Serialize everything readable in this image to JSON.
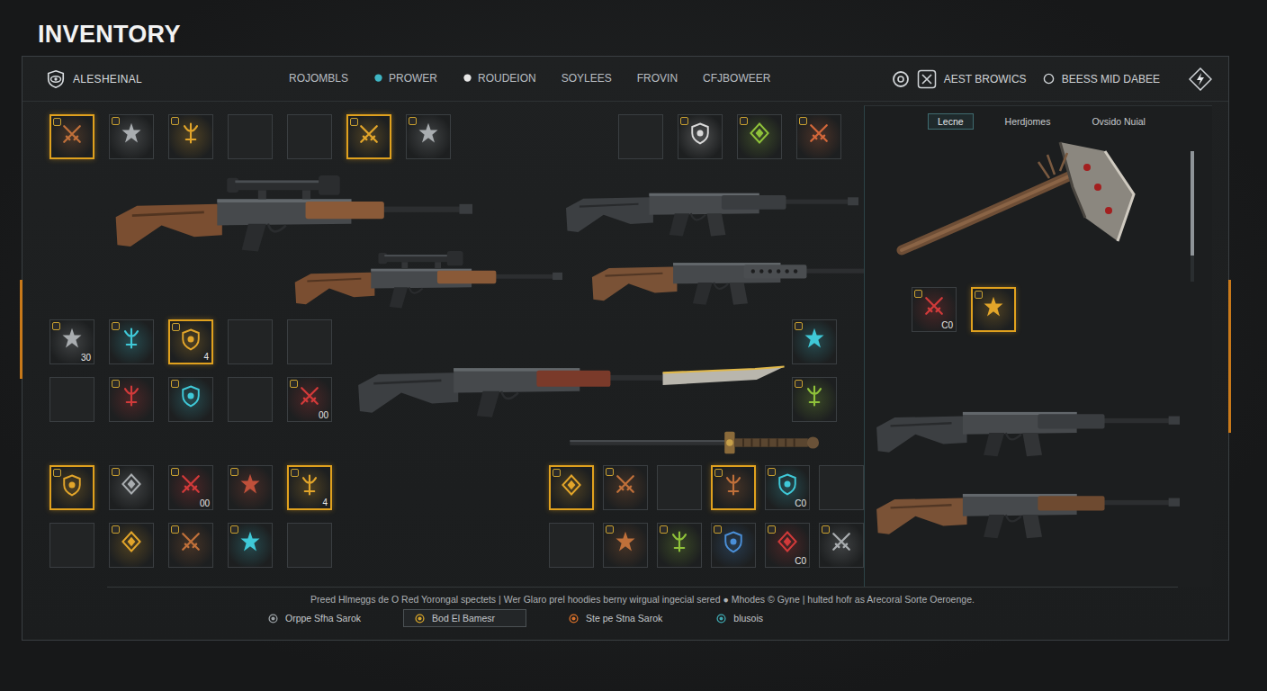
{
  "title": "INVENTORY",
  "header": {
    "brand": "ALESHEINAL",
    "tabs": [
      {
        "label": "ROJOMBLS",
        "selected": false,
        "kind": "plain"
      },
      {
        "label": "PROWER",
        "selected": false,
        "kind": "marked",
        "color": "#3fb6c4"
      },
      {
        "label": "ROUDEION",
        "selected": false,
        "kind": "marked",
        "color": "#e6e6e6"
      },
      {
        "label": "SOYLEES",
        "selected": false,
        "kind": "plain"
      },
      {
        "label": "FROVIN",
        "selected": false,
        "kind": "plain"
      },
      {
        "label": "CFJBOWEER",
        "selected": false,
        "kind": "plain"
      }
    ],
    "tools": [
      {
        "label": "AEST BROWICS",
        "kind": "icons"
      },
      {
        "label": "BEESS MID DABEE",
        "kind": "radio"
      }
    ]
  },
  "slots": {
    "top_left": [
      {
        "kind": "item",
        "highlighted": true,
        "color": "#c0703a"
      },
      {
        "kind": "item",
        "highlighted": false,
        "color": "#a9adb0"
      },
      {
        "kind": "item",
        "highlighted": false,
        "color": "#e2a52a"
      },
      {
        "kind": "empty",
        "highlighted": false
      },
      {
        "kind": "empty",
        "highlighted": false
      },
      {
        "kind": "item",
        "highlighted": true,
        "color": "#e2a52a"
      },
      {
        "kind": "item",
        "highlighted": false,
        "color": "#a9adb0"
      }
    ],
    "top_right": [
      {
        "kind": "empty",
        "highlighted": false
      },
      {
        "kind": "item",
        "highlighted": false,
        "color": "#d9d9d9"
      },
      {
        "kind": "item",
        "highlighted": false,
        "color": "#8fc23a"
      },
      {
        "kind": "item",
        "highlighted": false,
        "color": "#d2673a"
      }
    ],
    "mid_left": [
      {
        "kind": "item",
        "highlighted": false,
        "color": "#a9adb0",
        "count": "30"
      },
      {
        "kind": "item",
        "highlighted": false,
        "color": "#3fc9d8"
      },
      {
        "kind": "item",
        "highlighted": true,
        "color": "#e2a52a",
        "count": "4"
      },
      {
        "kind": "empty",
        "highlighted": false
      },
      {
        "kind": "empty",
        "highlighted": false
      },
      {
        "kind": "empty",
        "highlighted": false
      },
      {
        "kind": "item",
        "highlighted": false,
        "color": "#d23a3a"
      },
      {
        "kind": "item",
        "highlighted": false,
        "color": "#3fc9d8"
      },
      {
        "kind": "empty",
        "highlighted": false
      },
      {
        "kind": "item",
        "highlighted": false,
        "color": "#d23a3a",
        "count": "00"
      }
    ],
    "mid_side": [
      {
        "kind": "item",
        "highlighted": false,
        "color": "#3fc9d8"
      },
      {
        "kind": "item",
        "highlighted": false,
        "color": "#8fc23a"
      }
    ],
    "bottom_left": [
      {
        "kind": "item",
        "highlighted": true,
        "color": "#e2a52a"
      },
      {
        "kind": "item",
        "highlighted": false,
        "color": "#a9adb0"
      },
      {
        "kind": "item",
        "highlighted": false,
        "color": "#d23a3a",
        "count": "00"
      },
      {
        "kind": "item",
        "highlighted": false,
        "color": "#c0503a"
      },
      {
        "kind": "item",
        "highlighted": true,
        "color": "#e2a52a",
        "count": "4"
      },
      {
        "kind": "empty",
        "highlighted": false
      },
      {
        "kind": "item",
        "highlighted": false,
        "color": "#e2a52a"
      },
      {
        "kind": "item",
        "highlighted": false,
        "color": "#c0703a"
      },
      {
        "kind": "item",
        "highlighted": false,
        "color": "#3fc9d8"
      },
      {
        "kind": "empty",
        "highlighted": false
      }
    ],
    "bottom_right": [
      {
        "kind": "item",
        "highlighted": true,
        "color": "#e2a52a"
      },
      {
        "kind": "item",
        "highlighted": false,
        "color": "#c0703a"
      },
      {
        "kind": "empty",
        "highlighted": false
      },
      {
        "kind": "item",
        "highlighted": true,
        "color": "#c0703a"
      },
      {
        "kind": "item",
        "highlighted": false,
        "color": "#3fc9d8",
        "count": "C0"
      },
      {
        "kind": "empty",
        "highlighted": false
      },
      {
        "kind": "empty",
        "highlighted": false
      },
      {
        "kind": "item",
        "highlighted": false,
        "color": "#c0703a"
      },
      {
        "kind": "item",
        "highlighted": false,
        "color": "#8fc23a"
      },
      {
        "kind": "item",
        "highlighted": false,
        "color": "#4a8fd8"
      },
      {
        "kind": "item",
        "highlighted": false,
        "color": "#d23a3a",
        "count": "C0"
      },
      {
        "kind": "item",
        "highlighted": false,
        "color": "#a9adb0"
      }
    ],
    "side_panel": [
      {
        "kind": "item",
        "highlighted": false,
        "color": "#d23a3a",
        "count": "C0"
      },
      {
        "kind": "item",
        "highlighted": true,
        "color": "#e2a52a"
      }
    ]
  },
  "side": {
    "tabs": [
      {
        "label": "Lecne",
        "selected": true
      },
      {
        "label": "Herdjomes",
        "selected": false
      },
      {
        "label": "Ovsido Nuial",
        "selected": false
      }
    ],
    "scroll_level": 0.8
  },
  "footer": {
    "hint": "Preed Hlmeggs de O Red Yorongal spectets | Wer Glaro prel hoodies berny wirgual ingecial sered ● Mhodes © Gyne | hulted hofr as Arecoral Sorte Oeroenge.",
    "actions": [
      {
        "label": "Orppe Sfha Sarok",
        "selected": false,
        "color": "#9aa0a4"
      },
      {
        "label": "Bod El Bamesr",
        "selected": true,
        "color": "#d6a42a"
      },
      {
        "label": "Ste pe Stna Sarok",
        "selected": false,
        "color": "#d8702a"
      },
      {
        "label": "blusois",
        "selected": false,
        "color": "#3fa8b0"
      }
    ]
  }
}
